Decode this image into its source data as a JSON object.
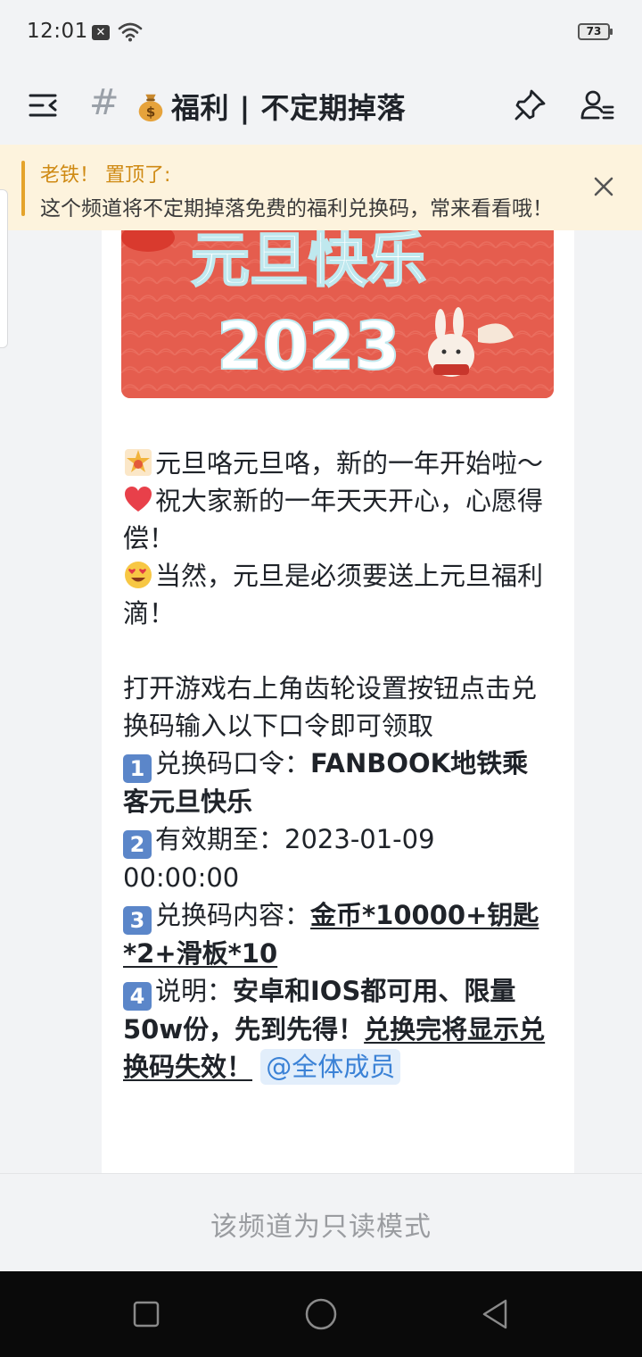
{
  "status_bar": {
    "time": "12:01",
    "notification_badge": "✕",
    "battery": "73"
  },
  "header": {
    "hash": "#",
    "title": "福利 | 不定期掉落",
    "title_icon": "money-bag-icon"
  },
  "pinned": {
    "author": "老铁！ 置顶了:",
    "text": "这个频道将不定期掉落免费的福利兑换码，常来看看哦！"
  },
  "banner": {
    "line1": "元旦快乐",
    "line2": "2023",
    "colors": {
      "bg": "#e55d4e",
      "text": "#ffffff"
    }
  },
  "message": {
    "greeting1": "元旦咯元旦咯，新的一年开始啦～",
    "greeting2": "祝大家新的一年天天开心，心愿得偿！",
    "greeting3": "当然，元旦是必须要送上元旦福利滴！",
    "instructions": "打开游戏右上角齿轮设置按钮点击兑换码输入以下口令即可领取",
    "item1_label": "兑换码口令：",
    "item1_value": "FANBOOK地铁乘客元旦快乐",
    "item2_label": "有效期至：",
    "item2_value": "2023-01-09 00:00:00",
    "item3_label": "兑换码内容：",
    "item3_value": "金币*10000+钥匙*2+滑板*10",
    "item4_label": "说明：",
    "item4_value": "安卓和IOS都可用、限量50w份，先到先得！",
    "item4_warning": "兑换完将显示兑换码失效！",
    "mention": "@全体成员",
    "numbers": [
      "1",
      "2",
      "3",
      "4"
    ]
  },
  "footer": {
    "readonly": "该频道为只读模式"
  },
  "colors": {
    "accent_blue": "#3b82d6",
    "pin_orange": "#cf8a14",
    "badge_blue": "#5b86c9"
  }
}
